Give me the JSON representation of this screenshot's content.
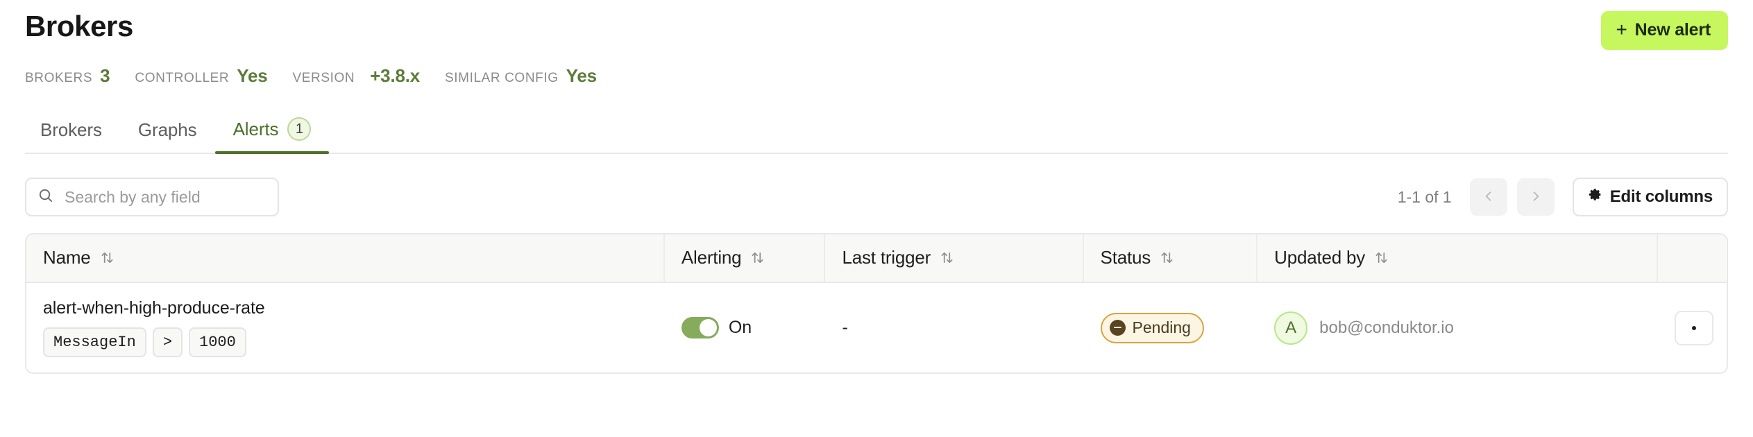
{
  "header": {
    "title": "Brokers",
    "new_alert_label": "New alert",
    "plus_icon": "plus-icon"
  },
  "meta": [
    {
      "label": "BROKERS",
      "value": "3"
    },
    {
      "label": "CONTROLLER",
      "value": "Yes"
    },
    {
      "label": "VERSION",
      "value": "+3.8.x"
    },
    {
      "label": "SIMILAR CONFIG",
      "value": "Yes"
    }
  ],
  "tabs": [
    {
      "label": "Brokers",
      "active": false,
      "badge": null
    },
    {
      "label": "Graphs",
      "active": false,
      "badge": null
    },
    {
      "label": "Alerts",
      "active": true,
      "badge": "1"
    }
  ],
  "toolbar": {
    "search_placeholder": "Search by any field",
    "search_value": "",
    "pagination_label": "1-1 of 1",
    "prev_icon": "chevron-left-icon",
    "next_icon": "chevron-right-icon",
    "edit_columns_label": "Edit columns",
    "gear_icon": "gear-icon"
  },
  "table": {
    "columns": [
      {
        "label": "Name",
        "sortable": true
      },
      {
        "label": "Alerting",
        "sortable": true
      },
      {
        "label": "Last trigger",
        "sortable": true
      },
      {
        "label": "Status",
        "sortable": true
      },
      {
        "label": "Updated by",
        "sortable": true
      },
      {
        "label": "",
        "sortable": false
      }
    ],
    "rows": [
      {
        "name": "alert-when-high-produce-rate",
        "condition": {
          "metric": "MessageIn",
          "operator": ">",
          "threshold": "1000"
        },
        "alerting": {
          "on": true,
          "label": "On"
        },
        "last_trigger": "-",
        "status": {
          "label": "Pending",
          "icon": "circle-minus-icon",
          "color": "#d7a43a"
        },
        "updated_by": {
          "avatar_initial": "A",
          "email": "bob@conduktor.io"
        },
        "actions_icon": "more-horizontal-icon"
      }
    ]
  },
  "colors": {
    "accent_green": "#5c7c39",
    "button_lime": "#c7f75e",
    "toggle_green": "#85ab5b",
    "status_amber": "#d7a43a"
  }
}
